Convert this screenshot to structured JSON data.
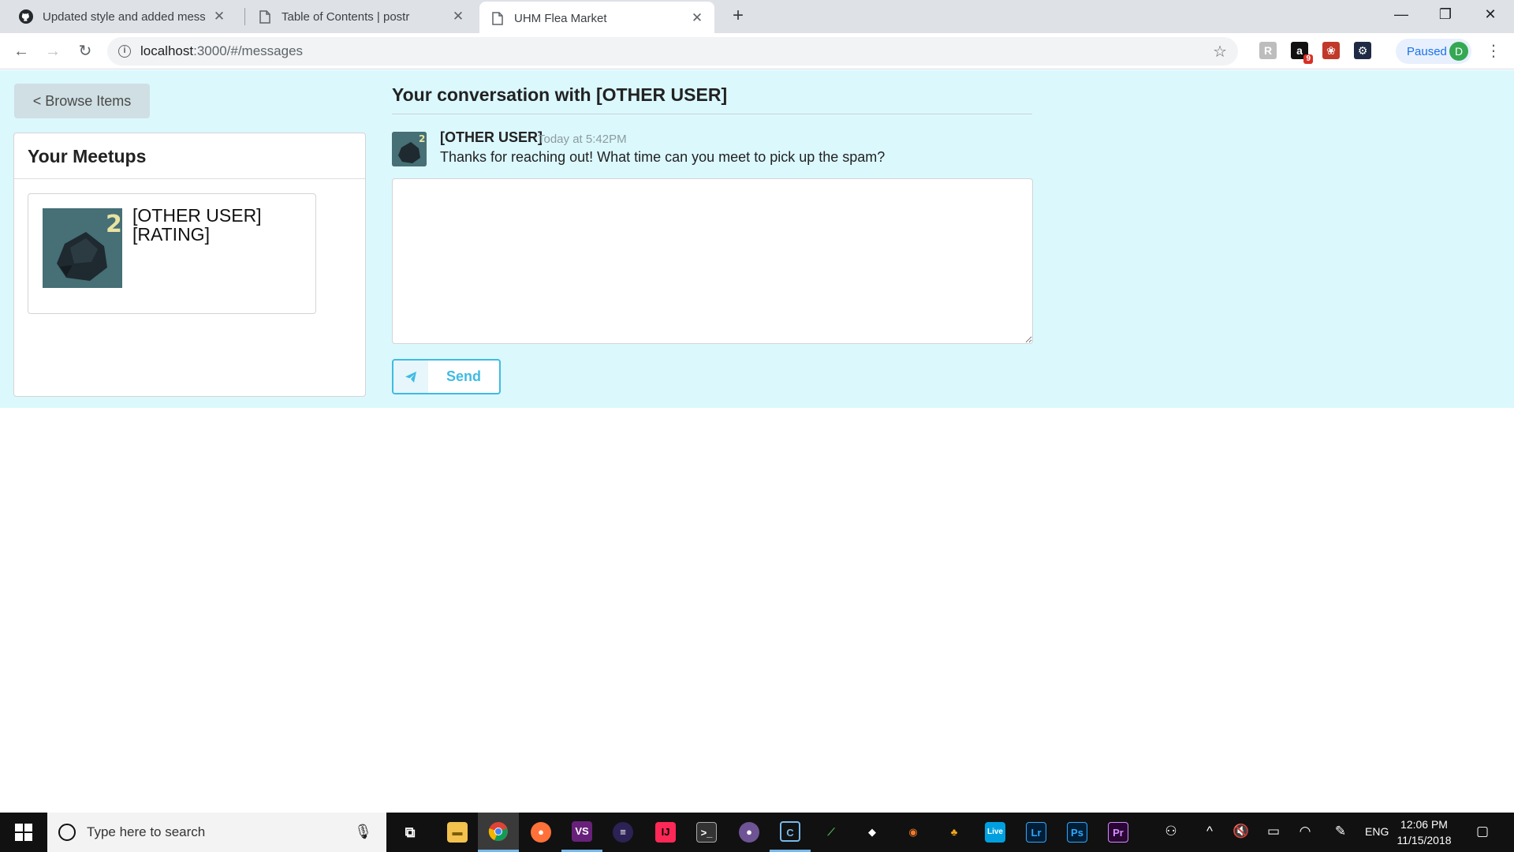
{
  "browser": {
    "tabs": [
      {
        "title": "Updated style and added messag",
        "icon": "github-icon"
      },
      {
        "title": "Table of Contents | postr",
        "icon": "page-icon"
      },
      {
        "title": "UHM Flea Market",
        "icon": "page-icon",
        "active": true
      }
    ],
    "url_host": "localhost",
    "url_path": ":3000/#/messages",
    "profile_status": "Paused",
    "profile_initial": "D",
    "extension_badge": "9"
  },
  "sidebar": {
    "browse_button_label": "< Browse Items",
    "meetups_title": "Your Meetups",
    "meetup": {
      "user": "[OTHER USER]",
      "rating": "[RATING]"
    }
  },
  "conversation": {
    "title": "Your conversation with [OTHER USER]",
    "messages": [
      {
        "author": "[OTHER USER]",
        "time": "Today at 5:42PM",
        "text": "Thanks for reaching out! What time can you meet to pick up the spam?"
      }
    ],
    "reply_value": "",
    "send_label": "Send"
  },
  "taskbar": {
    "search_placeholder": "Type here to search",
    "language": "ENG",
    "time": "12:06 PM",
    "date": "11/15/2018"
  },
  "colors": {
    "page_background": "#dbf8fd",
    "accent": "#3fbbe3",
    "avatar_bg": "#466f76"
  }
}
